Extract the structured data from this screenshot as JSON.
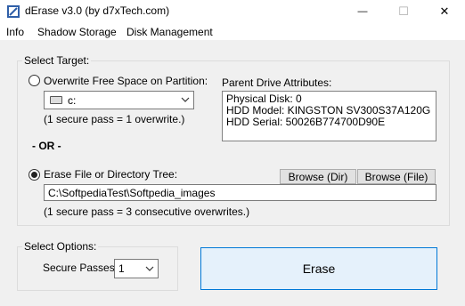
{
  "window": {
    "title": "dErase  v3.0 (by d7xTech.com)",
    "min_glyph": "—",
    "max_glyph": "☐",
    "close_glyph": "✕"
  },
  "menu": {
    "items": [
      "Info",
      "Shadow Storage",
      "Disk Management"
    ]
  },
  "select_target": {
    "group_label": "Select Target:",
    "overwrite_label": "Overwrite Free Space on Partition:",
    "overwrite_checked": false,
    "partition_value": "c:",
    "partition_note": "(1 secure pass = 1 overwrite.)",
    "or_label": "- OR -",
    "file_label": "Erase File or Directory Tree:",
    "file_checked": true,
    "path_value": "C:\\SoftpediaTest\\Softpedia_images",
    "path_note": "(1 secure pass = 3 consecutive overwrites.)",
    "browse_dir": "Browse (Dir)",
    "browse_file": "Browse (File)"
  },
  "parent_drive": {
    "label": "Parent Drive Attributes:",
    "lines": [
      "Physical Disk:  0",
      "HDD Model:  KINGSTON SV300S37A120G",
      "HDD Serial:  50026B774700D90E"
    ]
  },
  "select_options": {
    "group_label": "Select Options:",
    "passes_label": "Secure Passes:",
    "passes_value": "1"
  },
  "erase_button": "Erase"
}
